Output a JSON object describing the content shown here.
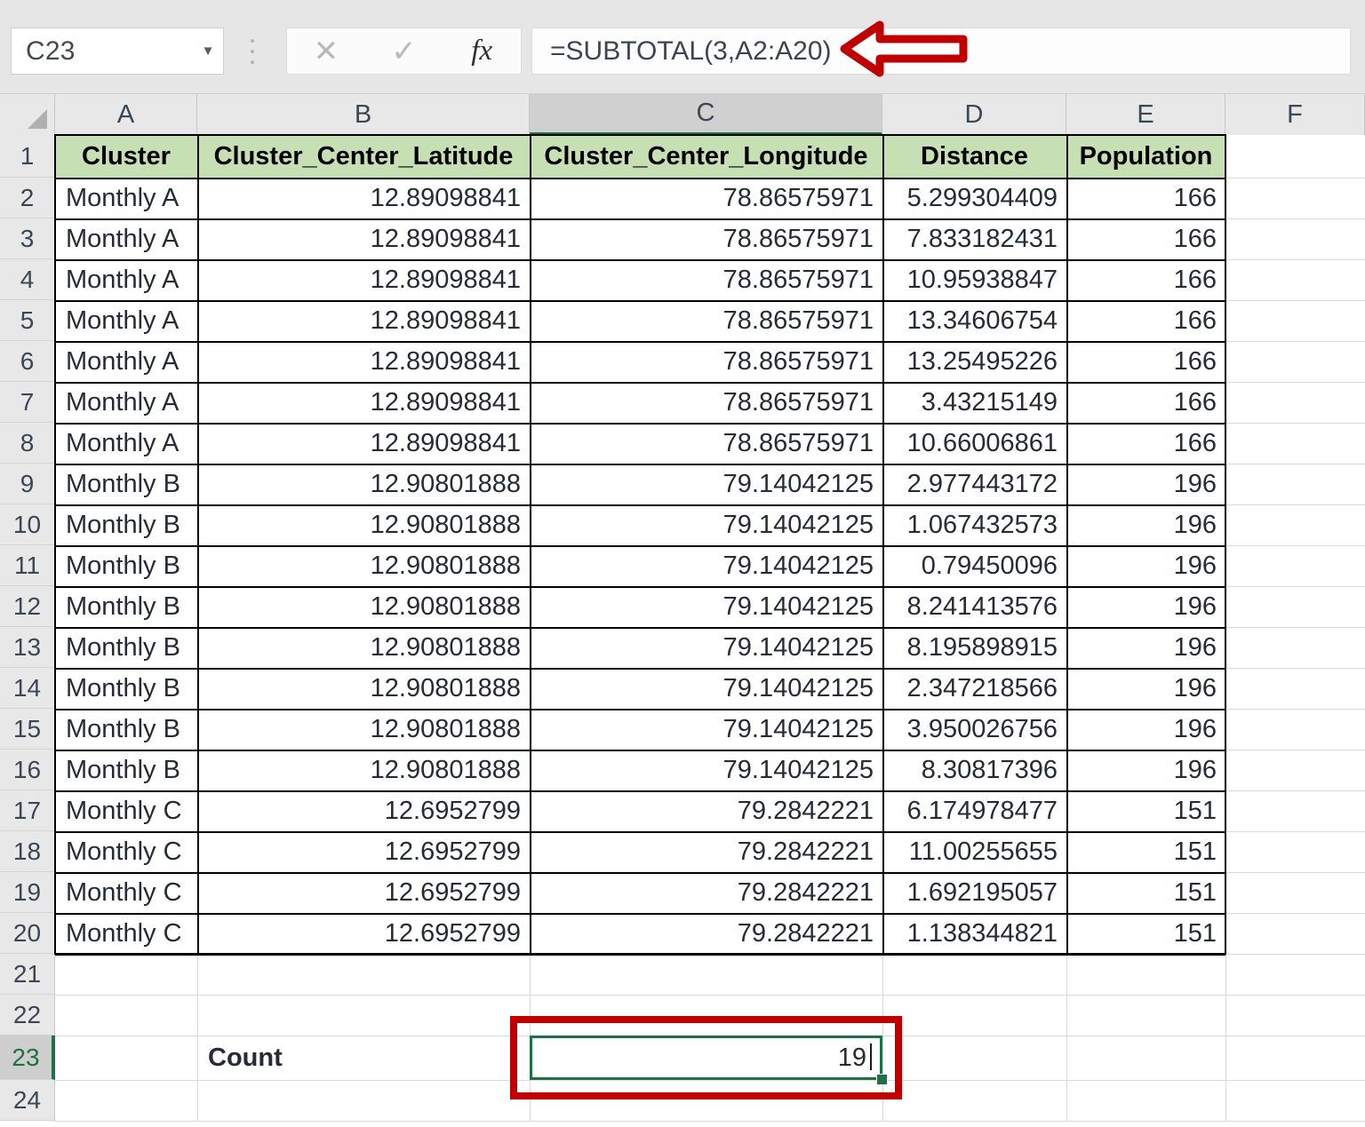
{
  "app": "excel-spreadsheet",
  "formula_bar": {
    "name_box_value": "C23",
    "name_box_caret_icon": "chevron-down-icon",
    "cancel_icon": "cancel-x-icon",
    "enter_icon": "confirm-check-icon",
    "function_icon": "insert-function-fx-icon",
    "formula": "=SUBTOTAL(3,A2:A20)",
    "annotation_arrow_icon": "red-left-arrow-icon"
  },
  "grid": {
    "column_letters": [
      "A",
      "B",
      "C",
      "D",
      "E",
      "F"
    ],
    "active_column": "C",
    "active_row": 23,
    "row_numbers": [
      1,
      2,
      3,
      4,
      5,
      6,
      7,
      8,
      9,
      10,
      11,
      12,
      13,
      14,
      15,
      16,
      17,
      18,
      19,
      20,
      21,
      22,
      23,
      24
    ],
    "header_fill": "#C6E0B4",
    "selection_color": "#1E7145",
    "annotation_color": "#C00000"
  },
  "table": {
    "headers": [
      "Cluster",
      "Cluster_Center_Latitude",
      "Cluster_Center_Longitude",
      "Distance",
      "Population"
    ],
    "rows": [
      [
        "Monthly A",
        "12.89098841",
        "78.86575971",
        "5.299304409",
        "166"
      ],
      [
        "Monthly A",
        "12.89098841",
        "78.86575971",
        "7.833182431",
        "166"
      ],
      [
        "Monthly A",
        "12.89098841",
        "78.86575971",
        "10.95938847",
        "166"
      ],
      [
        "Monthly A",
        "12.89098841",
        "78.86575971",
        "13.34606754",
        "166"
      ],
      [
        "Monthly A",
        "12.89098841",
        "78.86575971",
        "13.25495226",
        "166"
      ],
      [
        "Monthly A",
        "12.89098841",
        "78.86575971",
        "3.43215149",
        "166"
      ],
      [
        "Monthly A",
        "12.89098841",
        "78.86575971",
        "10.66006861",
        "166"
      ],
      [
        "Monthly B",
        "12.90801888",
        "79.14042125",
        "2.977443172",
        "196"
      ],
      [
        "Monthly B",
        "12.90801888",
        "79.14042125",
        "1.067432573",
        "196"
      ],
      [
        "Monthly B",
        "12.90801888",
        "79.14042125",
        "0.79450096",
        "196"
      ],
      [
        "Monthly B",
        "12.90801888",
        "79.14042125",
        "8.241413576",
        "196"
      ],
      [
        "Monthly B",
        "12.90801888",
        "79.14042125",
        "8.195898915",
        "196"
      ],
      [
        "Monthly B",
        "12.90801888",
        "79.14042125",
        "2.347218566",
        "196"
      ],
      [
        "Monthly B",
        "12.90801888",
        "79.14042125",
        "3.950026756",
        "196"
      ],
      [
        "Monthly B",
        "12.90801888",
        "79.14042125",
        "8.30817396",
        "196"
      ],
      [
        "Monthly C",
        "12.6952799",
        "79.2842221",
        "6.174978477",
        "151"
      ],
      [
        "Monthly C",
        "12.6952799",
        "79.2842221",
        "11.00255655",
        "151"
      ],
      [
        "Monthly C",
        "12.6952799",
        "79.2842221",
        "1.692195057",
        "151"
      ],
      [
        "Monthly C",
        "12.6952799",
        "79.2842221",
        "1.138344821",
        "151"
      ]
    ]
  },
  "summary": {
    "label": "Count",
    "label_cell": "B23",
    "value": "19",
    "value_cell": "C23"
  }
}
